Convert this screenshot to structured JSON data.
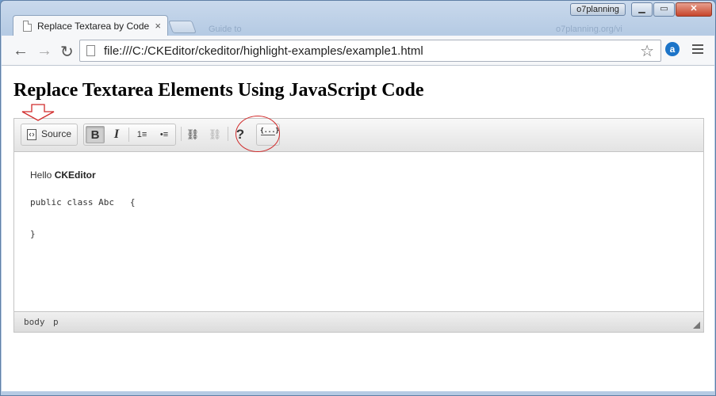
{
  "browser": {
    "tab_title": "Replace Textarea by Code",
    "tab_close": "×",
    "ghost_tab": "Guide to",
    "ghost_right": "o7planning.org/vi",
    "user_badge": "o7planning",
    "win_min": "▁",
    "win_max": "▭",
    "win_close": "✕",
    "url": "file:///C:/CKEditor/ckeditor/highlight-examples/example1.html",
    "nav_back": "←",
    "nav_forward": "→",
    "nav_reload": "↻",
    "star": "☆",
    "ext": "a"
  },
  "page": {
    "heading": "Replace Textarea Elements Using JavaScript Code"
  },
  "editor": {
    "toolbar": {
      "source_label": "Source",
      "bold": "B",
      "italic": "I",
      "numbered_list": "1≡",
      "bulleted_list": "•≡",
      "link": "⛓",
      "unlink": "⛓",
      "about": "?",
      "code_snippet": "{...}"
    },
    "content": {
      "hello": "Hello ",
      "hello_bold": "CKEditor",
      "code_line1": "public class Abc   {",
      "code_line2": "}"
    },
    "elementspath": [
      "body",
      "p"
    ]
  },
  "colors": {
    "annotation": "#d12b2b",
    "close_button": "#c7452b",
    "title_bar": "#c9d9ec"
  }
}
